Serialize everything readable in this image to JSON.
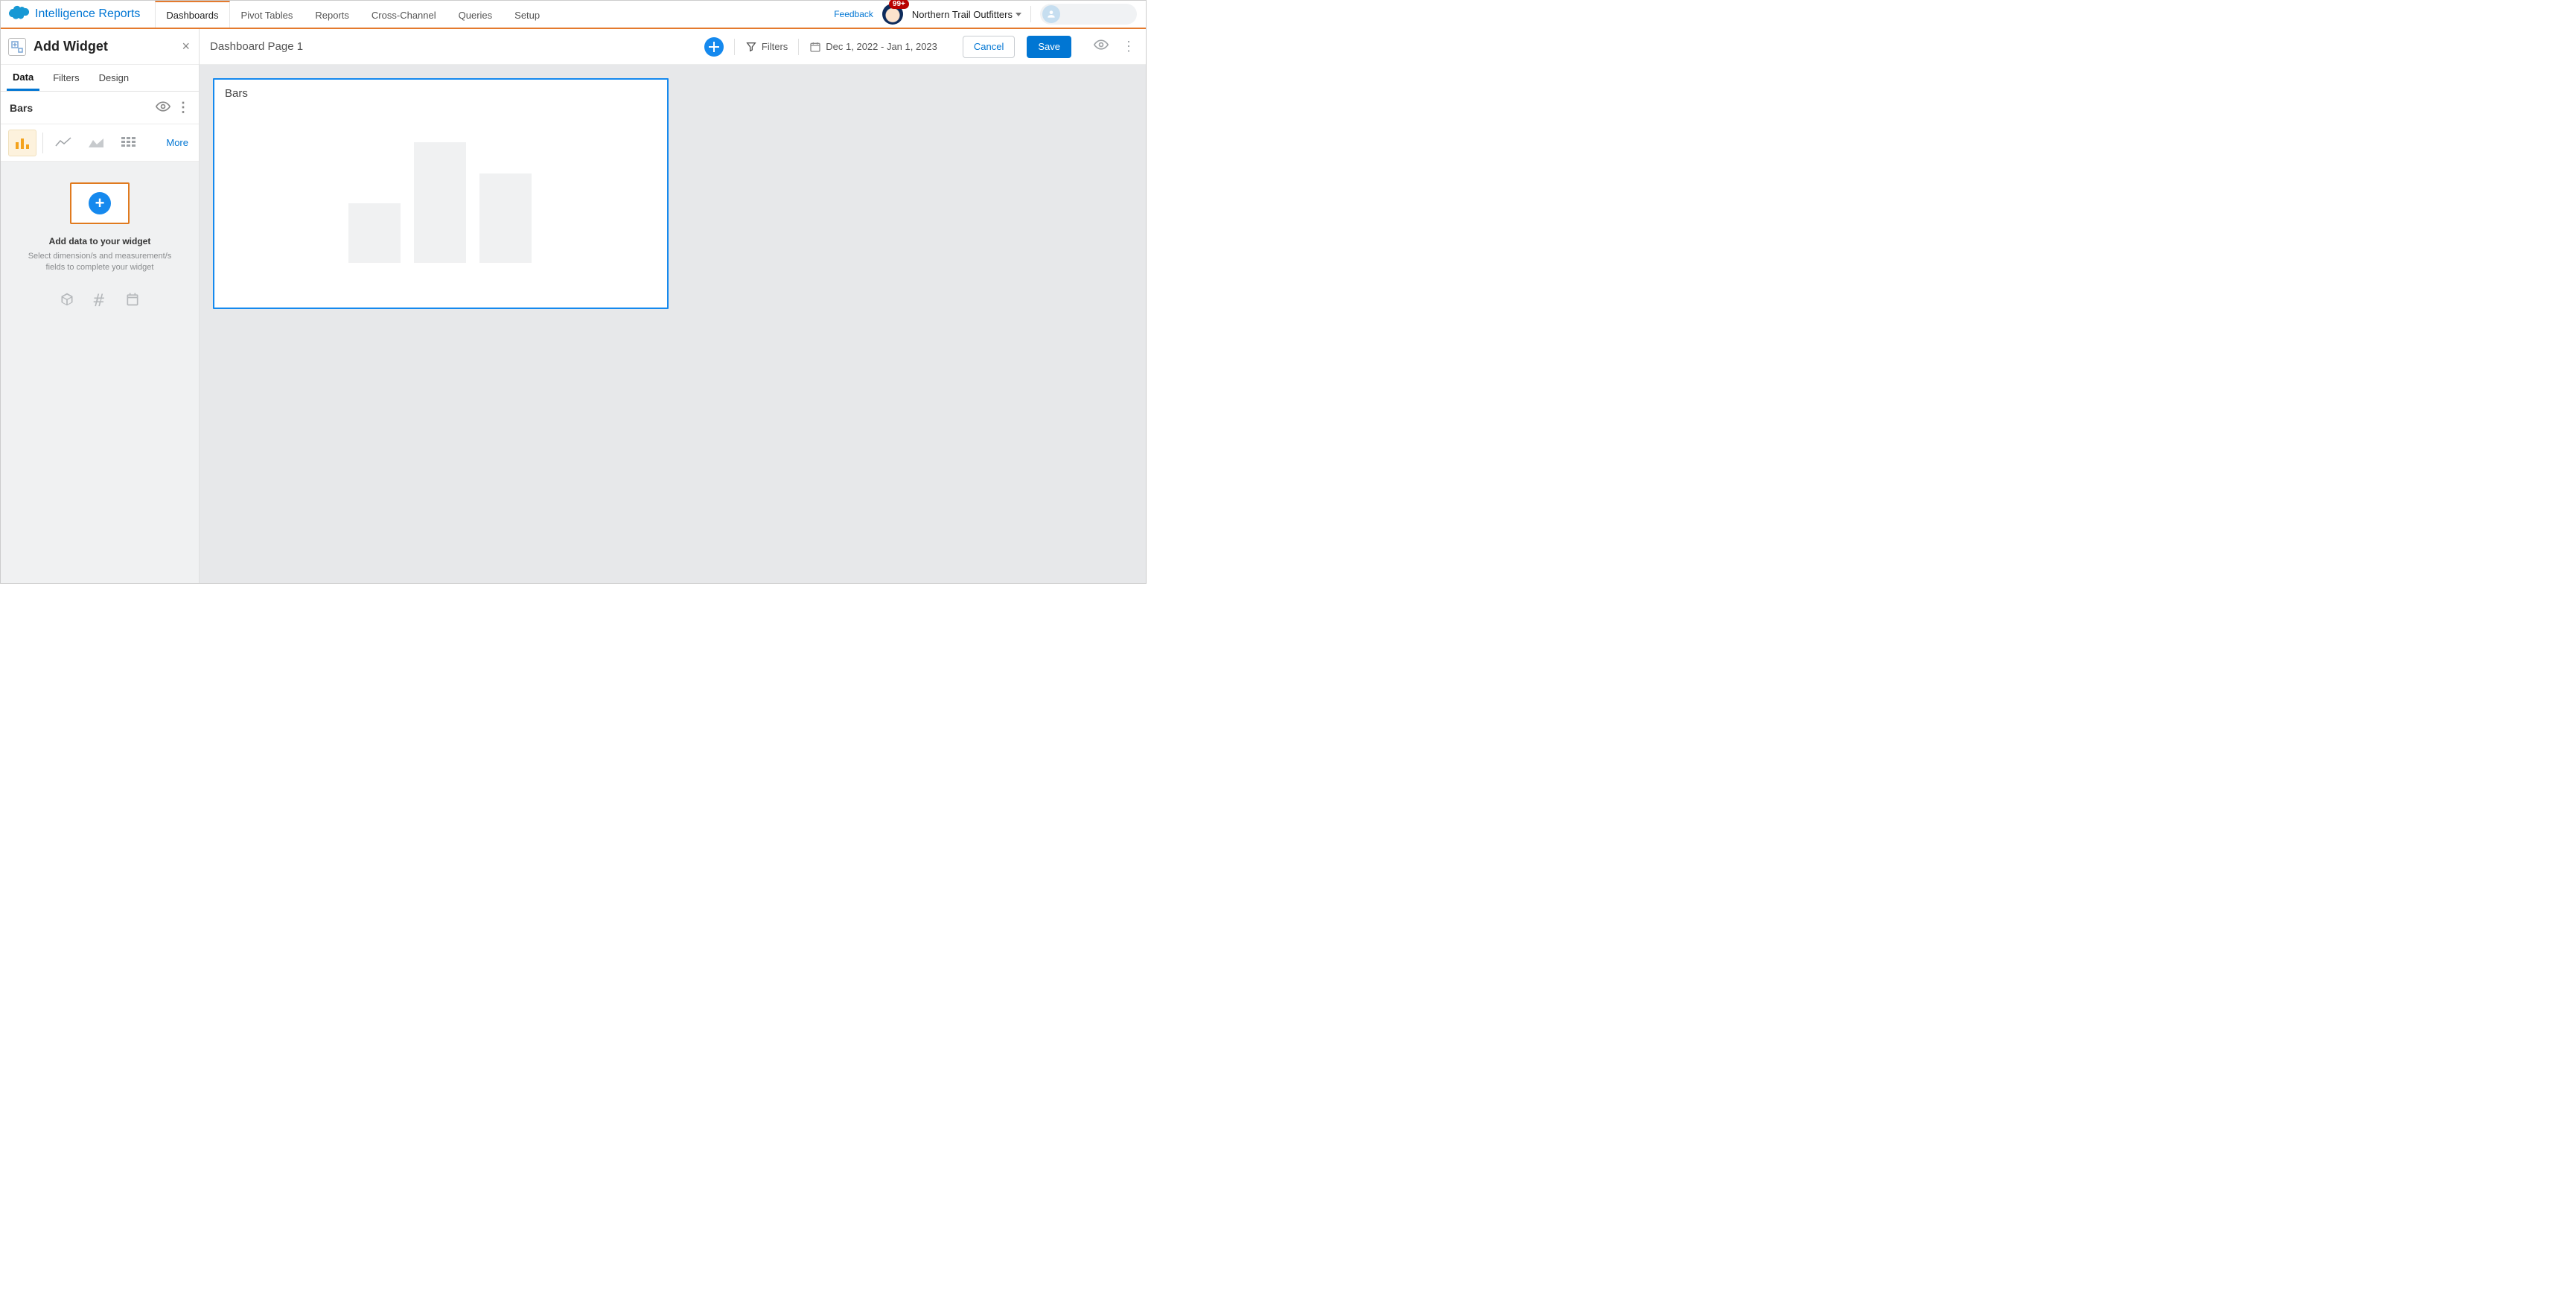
{
  "header": {
    "product_name": "Intelligence Reports",
    "tabs": [
      "Dashboards",
      "Pivot Tables",
      "Reports",
      "Cross-Channel",
      "Queries",
      "Setup"
    ],
    "feedback_label": "Feedback",
    "notification_count": "99+",
    "org_name": "Northern Trail Outfitters"
  },
  "left_panel": {
    "title": "Add Widget",
    "tabs": [
      "Data",
      "Filters",
      "Design"
    ],
    "active_tab": "Data",
    "widget_name": "Bars",
    "chart_type_more": "More",
    "empty_state": {
      "title": "Add data to your widget",
      "description": "Select dimension/s and measurement/s fields to complete your widget"
    }
  },
  "canvas": {
    "page_title": "Dashboard Page 1",
    "filters_label": "Filters",
    "date_range": "Dec 1, 2022 - Jan 1, 2023",
    "cancel_label": "Cancel",
    "save_label": "Save",
    "widget_title": "Bars"
  },
  "chart_data": {
    "type": "bar",
    "categories": [
      "",
      "",
      ""
    ],
    "values": [
      80,
      162,
      120
    ],
    "title": "Bars",
    "xlabel": "",
    "ylabel": "",
    "note": "placeholder bars — no axes or numeric scale shown"
  }
}
